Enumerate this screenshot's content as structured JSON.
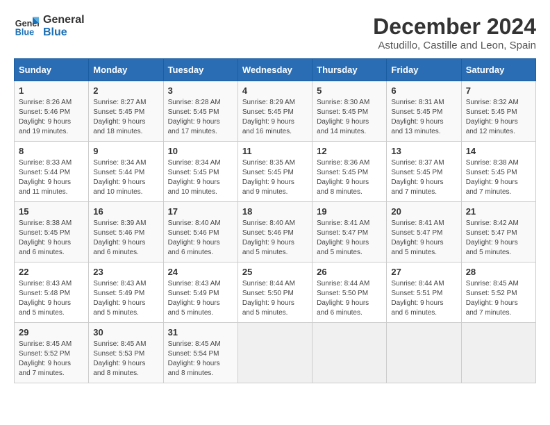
{
  "logo": {
    "line1": "General",
    "line2": "Blue"
  },
  "title": "December 2024",
  "location": "Astudillo, Castille and Leon, Spain",
  "days_of_week": [
    "Sunday",
    "Monday",
    "Tuesday",
    "Wednesday",
    "Thursday",
    "Friday",
    "Saturday"
  ],
  "weeks": [
    [
      {
        "day": "1",
        "sunrise": "8:26 AM",
        "sunset": "5:46 PM",
        "daylight": "9 hours and 19 minutes."
      },
      {
        "day": "2",
        "sunrise": "8:27 AM",
        "sunset": "5:45 PM",
        "daylight": "9 hours and 18 minutes."
      },
      {
        "day": "3",
        "sunrise": "8:28 AM",
        "sunset": "5:45 PM",
        "daylight": "9 hours and 17 minutes."
      },
      {
        "day": "4",
        "sunrise": "8:29 AM",
        "sunset": "5:45 PM",
        "daylight": "9 hours and 16 minutes."
      },
      {
        "day": "5",
        "sunrise": "8:30 AM",
        "sunset": "5:45 PM",
        "daylight": "9 hours and 14 minutes."
      },
      {
        "day": "6",
        "sunrise": "8:31 AM",
        "sunset": "5:45 PM",
        "daylight": "9 hours and 13 minutes."
      },
      {
        "day": "7",
        "sunrise": "8:32 AM",
        "sunset": "5:45 PM",
        "daylight": "9 hours and 12 minutes."
      }
    ],
    [
      {
        "day": "8",
        "sunrise": "8:33 AM",
        "sunset": "5:44 PM",
        "daylight": "9 hours and 11 minutes."
      },
      {
        "day": "9",
        "sunrise": "8:34 AM",
        "sunset": "5:44 PM",
        "daylight": "9 hours and 10 minutes."
      },
      {
        "day": "10",
        "sunrise": "8:34 AM",
        "sunset": "5:45 PM",
        "daylight": "9 hours and 10 minutes."
      },
      {
        "day": "11",
        "sunrise": "8:35 AM",
        "sunset": "5:45 PM",
        "daylight": "9 hours and 9 minutes."
      },
      {
        "day": "12",
        "sunrise": "8:36 AM",
        "sunset": "5:45 PM",
        "daylight": "9 hours and 8 minutes."
      },
      {
        "day": "13",
        "sunrise": "8:37 AM",
        "sunset": "5:45 PM",
        "daylight": "9 hours and 7 minutes."
      },
      {
        "day": "14",
        "sunrise": "8:38 AM",
        "sunset": "5:45 PM",
        "daylight": "9 hours and 7 minutes."
      }
    ],
    [
      {
        "day": "15",
        "sunrise": "8:38 AM",
        "sunset": "5:45 PM",
        "daylight": "9 hours and 6 minutes."
      },
      {
        "day": "16",
        "sunrise": "8:39 AM",
        "sunset": "5:46 PM",
        "daylight": "9 hours and 6 minutes."
      },
      {
        "day": "17",
        "sunrise": "8:40 AM",
        "sunset": "5:46 PM",
        "daylight": "9 hours and 6 minutes."
      },
      {
        "day": "18",
        "sunrise": "8:40 AM",
        "sunset": "5:46 PM",
        "daylight": "9 hours and 5 minutes."
      },
      {
        "day": "19",
        "sunrise": "8:41 AM",
        "sunset": "5:47 PM",
        "daylight": "9 hours and 5 minutes."
      },
      {
        "day": "20",
        "sunrise": "8:41 AM",
        "sunset": "5:47 PM",
        "daylight": "9 hours and 5 minutes."
      },
      {
        "day": "21",
        "sunrise": "8:42 AM",
        "sunset": "5:47 PM",
        "daylight": "9 hours and 5 minutes."
      }
    ],
    [
      {
        "day": "22",
        "sunrise": "8:43 AM",
        "sunset": "5:48 PM",
        "daylight": "9 hours and 5 minutes."
      },
      {
        "day": "23",
        "sunrise": "8:43 AM",
        "sunset": "5:49 PM",
        "daylight": "9 hours and 5 minutes."
      },
      {
        "day": "24",
        "sunrise": "8:43 AM",
        "sunset": "5:49 PM",
        "daylight": "9 hours and 5 minutes."
      },
      {
        "day": "25",
        "sunrise": "8:44 AM",
        "sunset": "5:50 PM",
        "daylight": "9 hours and 5 minutes."
      },
      {
        "day": "26",
        "sunrise": "8:44 AM",
        "sunset": "5:50 PM",
        "daylight": "9 hours and 6 minutes."
      },
      {
        "day": "27",
        "sunrise": "8:44 AM",
        "sunset": "5:51 PM",
        "daylight": "9 hours and 6 minutes."
      },
      {
        "day": "28",
        "sunrise": "8:45 AM",
        "sunset": "5:52 PM",
        "daylight": "9 hours and 7 minutes."
      }
    ],
    [
      {
        "day": "29",
        "sunrise": "8:45 AM",
        "sunset": "5:52 PM",
        "daylight": "9 hours and 7 minutes."
      },
      {
        "day": "30",
        "sunrise": "8:45 AM",
        "sunset": "5:53 PM",
        "daylight": "9 hours and 8 minutes."
      },
      {
        "day": "31",
        "sunrise": "8:45 AM",
        "sunset": "5:54 PM",
        "daylight": "9 hours and 8 minutes."
      },
      null,
      null,
      null,
      null
    ]
  ],
  "labels": {
    "sunrise": "Sunrise:",
    "sunset": "Sunset:",
    "daylight": "Daylight:"
  }
}
